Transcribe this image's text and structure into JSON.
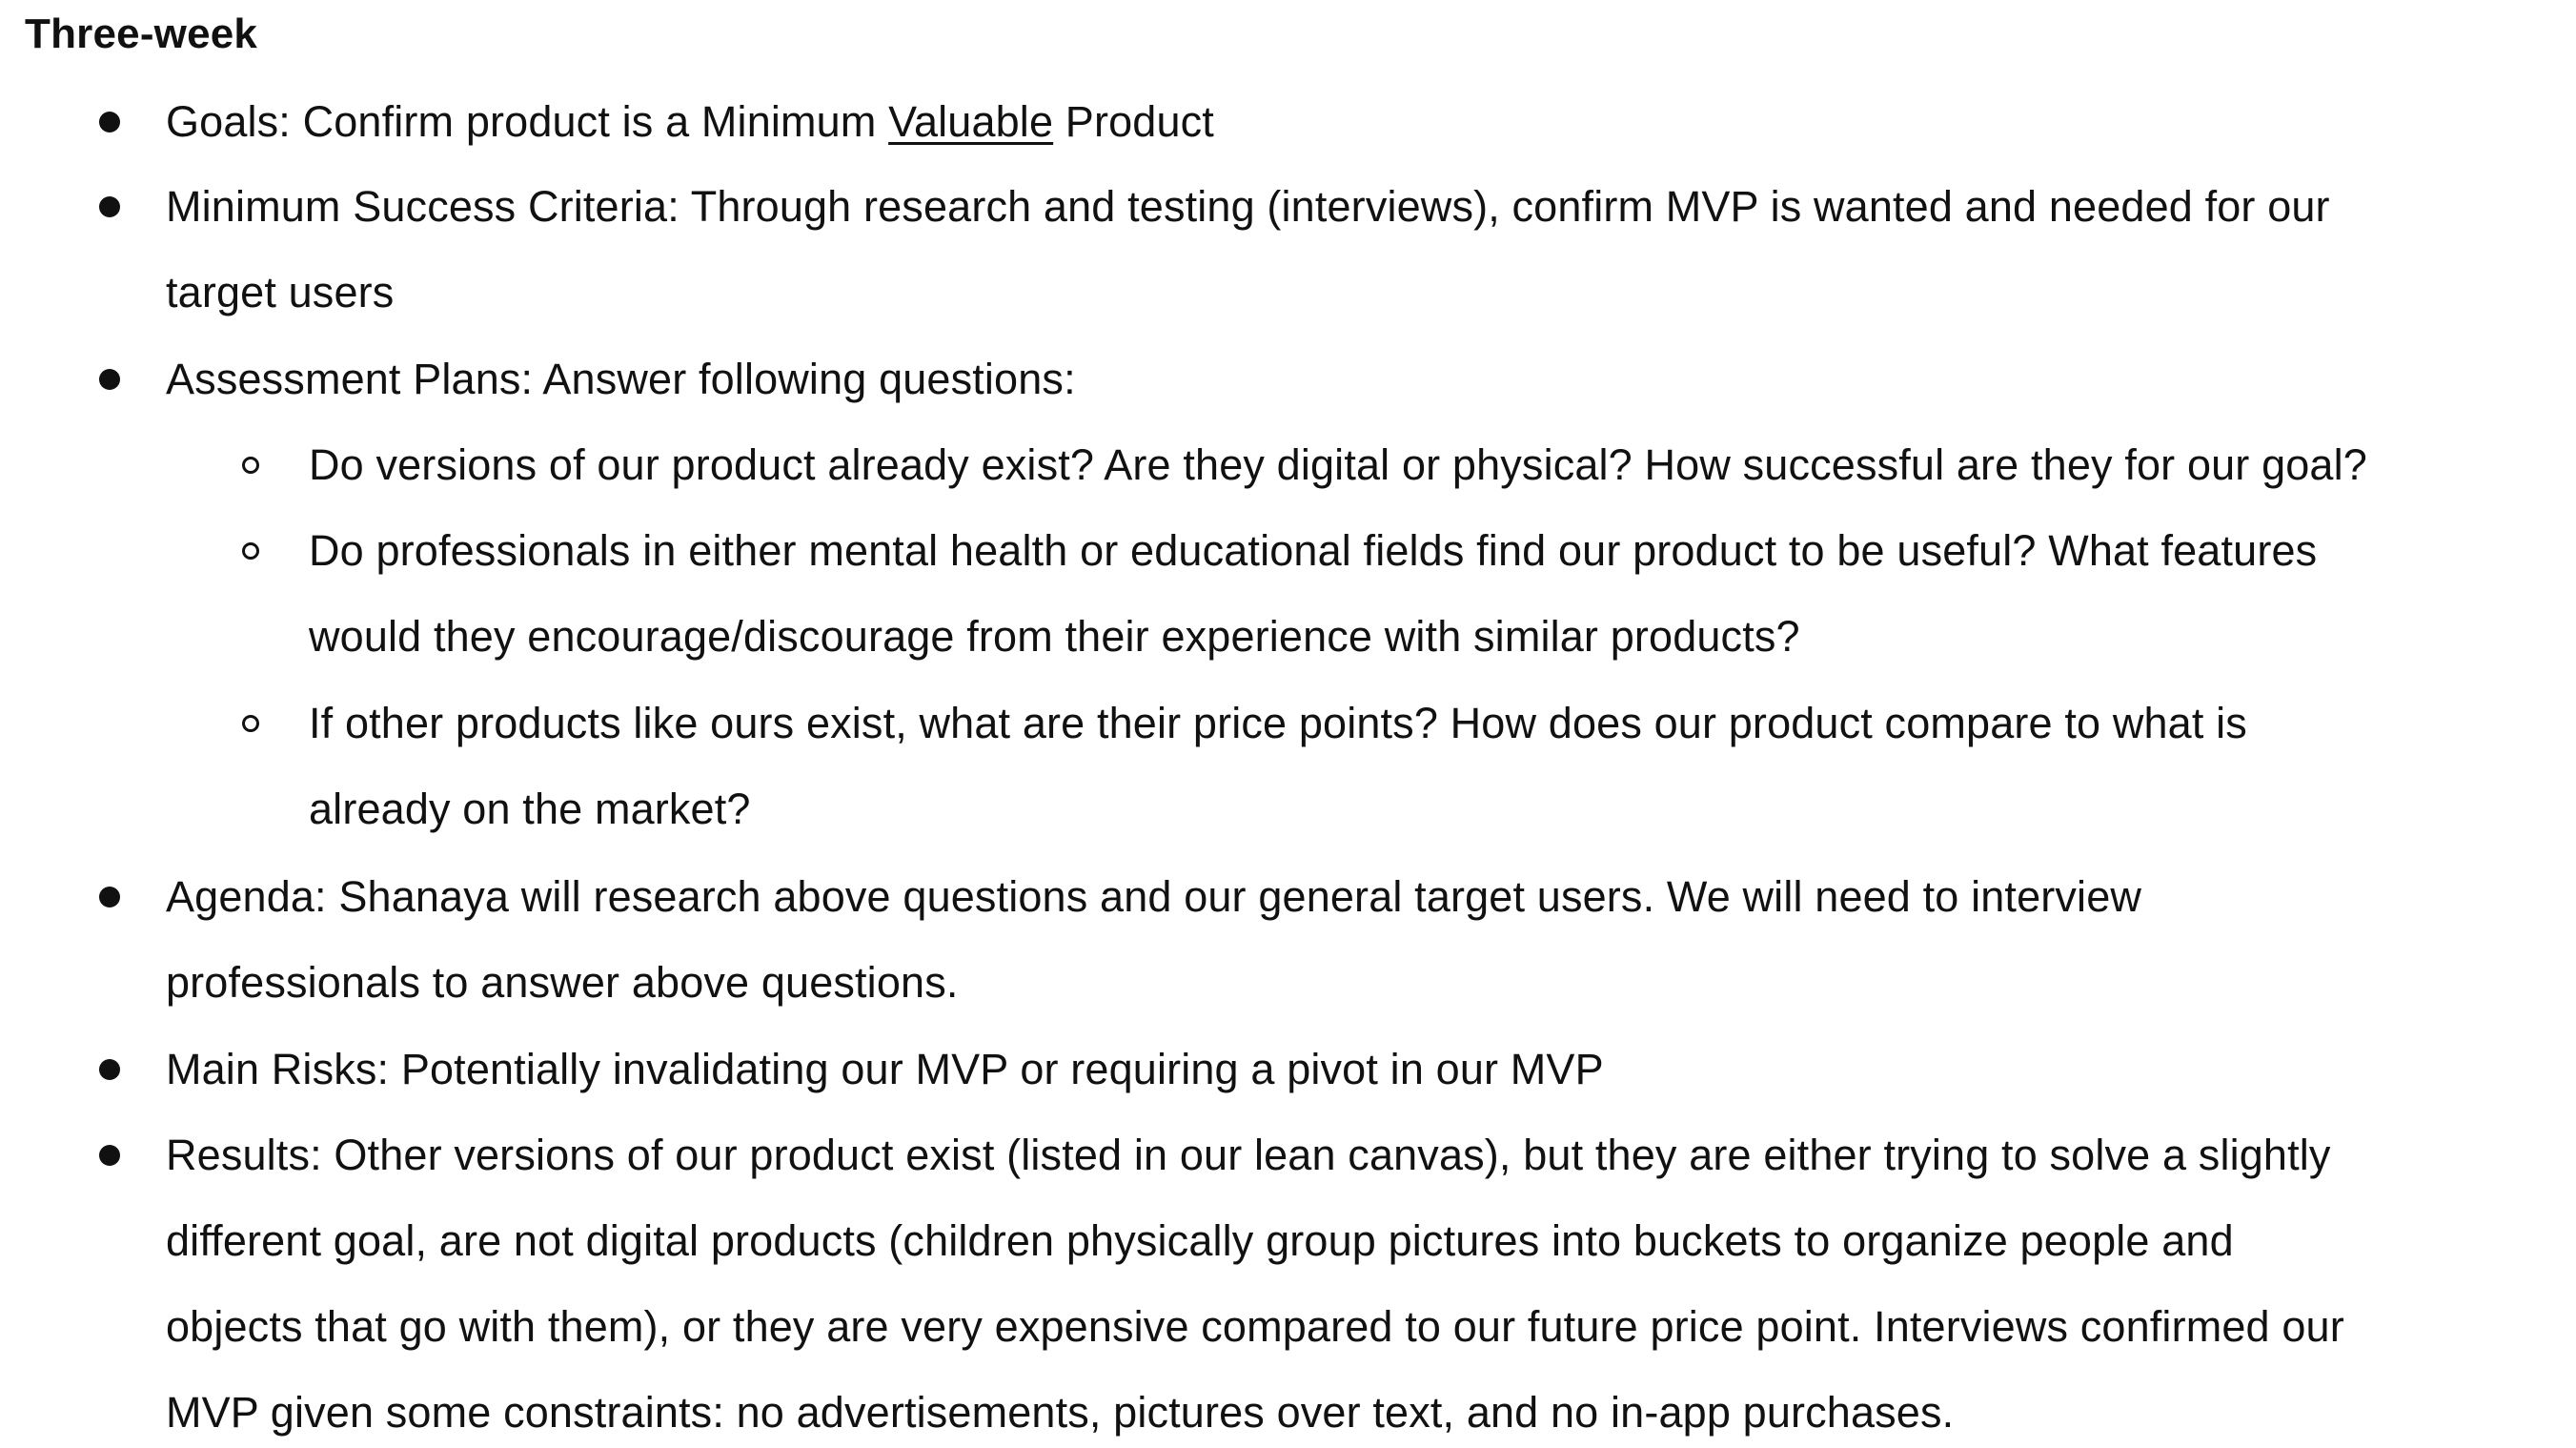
{
  "heading": "Three-week",
  "items": [
    {
      "lines": [
        {
          "pre": "Goals: Confirm product is a Minimum ",
          "underlined": "Valuable",
          "post": " Product"
        }
      ]
    },
    {
      "lines": [
        "Minimum Success Criteria: Through research and testing (interviews), confirm MVP is wanted and needed for our",
        "target users"
      ]
    },
    {
      "lines": [
        "Assessment Plans: Answer following questions:"
      ],
      "subitems": [
        {
          "lines": [
            "Do versions of our product already exist?  Are they digital or physical?  How successful are they for our goal?"
          ]
        },
        {
          "lines": [
            "Do professionals in either mental health or educational fields find our product to be useful?  What features",
            "would they encourage/discourage from their experience with similar products?"
          ]
        },
        {
          "lines": [
            "If other products like ours exist, what are their price points?  How does our product compare to what is",
            "already on the market?"
          ]
        }
      ]
    },
    {
      "lines": [
        "Agenda: Shanaya will research above questions and our general target users.  We will need to interview",
        "professionals to answer above questions."
      ]
    },
    {
      "lines": [
        "Main Risks: Potentially invalidating our MVP or requiring a pivot in our MVP"
      ]
    },
    {
      "lines": [
        "Results: Other versions of our product exist (listed in our lean canvas), but they are either trying to solve a slightly",
        "different goal, are not digital products (children physically group pictures into buckets to organize people and",
        "objects that go with them), or they are very expensive compared to our future price point.  Interviews confirmed our",
        "MVP given some constraints: no advertisements, pictures over text, and no in-app purchases."
      ]
    }
  ]
}
